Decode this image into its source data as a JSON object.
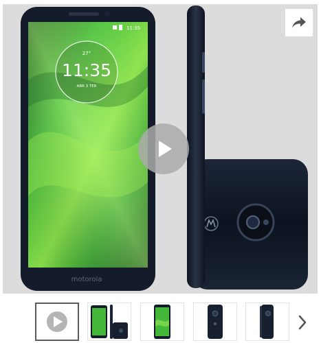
{
  "product_image": {
    "status_bar": {
      "time": "11:35"
    },
    "clock": {
      "temperature": "27°",
      "time": "11:35",
      "date": "ABR 3 TER"
    },
    "brand": "motorola"
  },
  "icons": {
    "share": "share-arrow-icon",
    "play": "play-icon",
    "next": "chevron-right-icon"
  },
  "thumbnails": [
    {
      "id": "video",
      "selected": true
    },
    {
      "id": "front-and-side",
      "selected": false
    },
    {
      "id": "front",
      "selected": false
    },
    {
      "id": "back",
      "selected": false
    },
    {
      "id": "back-angle",
      "selected": false
    }
  ],
  "colors": {
    "image_background": "#dcdcdc",
    "phone_body": "#131c2c",
    "screen_green": "#3fb33f",
    "thumb_border_active": "#5a5a5a"
  }
}
